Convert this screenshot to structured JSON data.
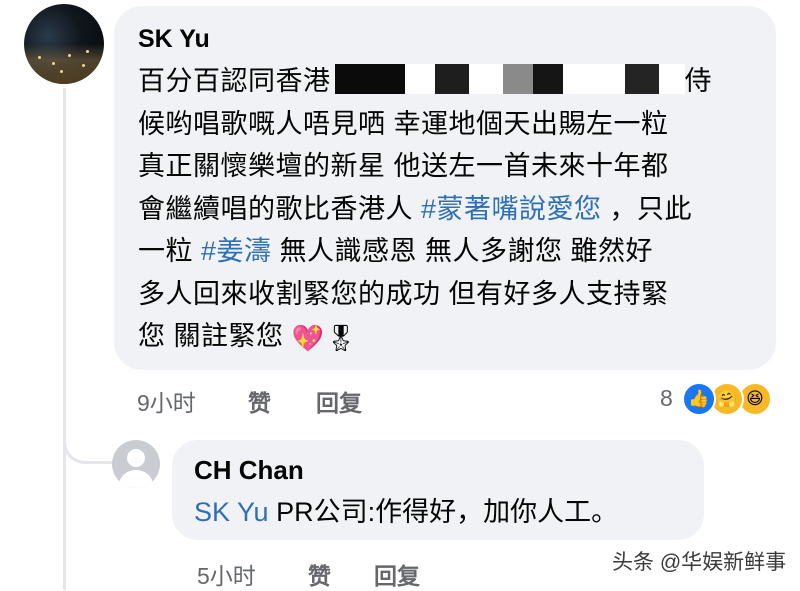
{
  "comment": {
    "author": "SK Yu",
    "lines": [
      [
        "百分百認同香港",
        "REDACT",
        "侍"
      ],
      [
        "候哟唱歌嘅人唔見哂  幸運地個天出賜左一粒"
      ],
      [
        "真正關懷樂壇的新星  他送左一首未來十年都"
      ],
      [
        "會繼續唱的歌比香港人 ",
        "#蒙著嘴說愛您",
        "，只此"
      ],
      [
        "一粒 ",
        "#姜濤",
        " 無人識感恩  無人多謝您    雖然好"
      ],
      [
        "多人回來收割緊您的成功  但有好多人支持緊"
      ],
      [
        "您  關註緊您 "
      ]
    ],
    "line1_start": "百分百認同香港",
    "line1_end": "侍",
    "line2": "候哟唱歌嘅人唔見哂  幸運地個天出賜左一粒",
    "line3": "真正關懷樂壇的新星  他送左一首未來十年都",
    "line4_start": "會繼續唱的歌比香港人 ",
    "hashtag1": "#蒙著嘴說愛您",
    "line4_end": " ，只此",
    "line5_start": "一粒 ",
    "hashtag2": "#姜濤",
    "line5_end": "  無人識感恩  無人多謝您    雖然好",
    "line6": "多人回來收割緊您的成功  但有好多人支持緊",
    "line7": "您  關註緊您 ",
    "emojis": [
      "💖",
      "🎖"
    ],
    "time": "9小时",
    "like_label": "赞",
    "reply_label": "回复",
    "reaction_count": "8",
    "reactions": [
      "like-icon",
      "care-icon",
      "haha-icon"
    ]
  },
  "reply": {
    "author": "CH Chan",
    "mention": "SK Yu",
    "text": " PR公司:作得好，加你人工。",
    "time": "5小时",
    "like_label": "赞",
    "reply_label": "回复"
  },
  "watermark": "头条 @华娱新鲜事",
  "colors": {
    "bubble": "#f0f2f5",
    "link": "#2f6fb5",
    "meta": "#65676b",
    "like": "#1877f2",
    "care": "#f7b928"
  }
}
